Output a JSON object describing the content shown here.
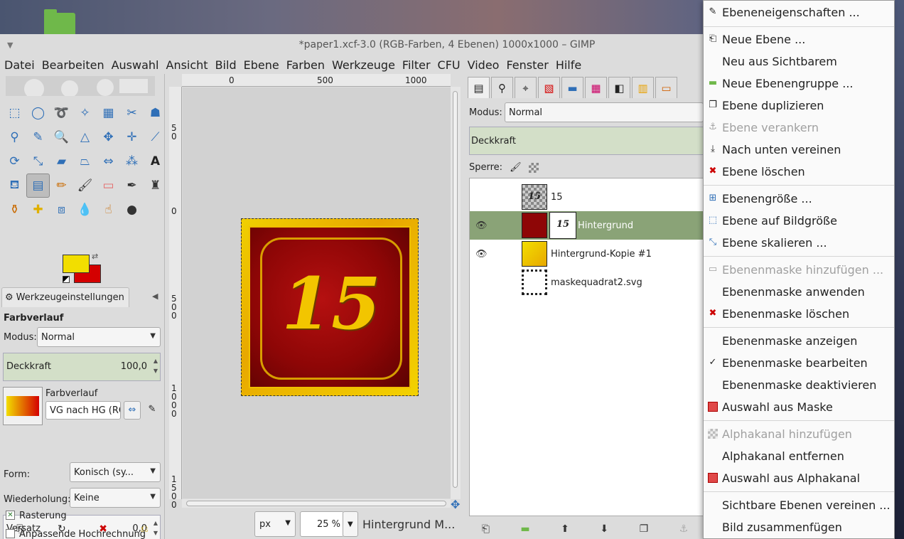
{
  "window": {
    "title": "*paper1.xcf-3.0 (RGB-Farben, 4 Ebenen) 1000x1000 – GIMP"
  },
  "menubar": [
    "Datei",
    "Bearbeiten",
    "Auswahl",
    "Ansicht",
    "Bild",
    "Ebene",
    "Farben",
    "Werkzeuge",
    "Filter",
    "CFU",
    "Video",
    "Fenster",
    "Hilfe"
  ],
  "tool_options": {
    "tab_label": "Werkzeugeinstellungen",
    "tool_name": "Farbverlauf",
    "mode_label": "Modus:",
    "mode_value": "Normal",
    "opacity_label": "Deckkraft",
    "opacity_value": "100,0",
    "gradient_label": "Farbverlauf",
    "gradient_value": "VG nach HG (RG",
    "shape_label": "Form:",
    "shape_value": "Konisch (sy...",
    "repeat_label": "Wiederholung:",
    "repeat_value": "Keine",
    "offset_label": "Versatz",
    "offset_value": "0,0",
    "dither_label": "Rasterung",
    "dither_checked": true,
    "adaptive_label": "Anpassende Hochrechnung",
    "adaptive_checked": false
  },
  "colors": {
    "foreground": "#f2de00",
    "background": "#d40000",
    "selection": "#8aa377",
    "slider": "#d3dfc8"
  },
  "canvas": {
    "ruler_top": [
      "0",
      "500",
      "1000"
    ],
    "ruler_left": [
      "5\n0",
      "0",
      "5\n0\n0",
      "1\n0\n0\n0",
      "1\n5\n0\n0"
    ],
    "image_text": "15",
    "unit": "px",
    "zoom": "25 %",
    "status": "Hintergrund M..."
  },
  "layers": {
    "mode_label": "Modus:",
    "mode_value": "Normal",
    "opacity_label": "Deckkraft",
    "lock_label": "Sperre:",
    "items": [
      {
        "name": "15",
        "visible": false,
        "selected": false,
        "mask": false
      },
      {
        "name": "Hintergrund",
        "visible": true,
        "selected": true,
        "mask": true
      },
      {
        "name": "Hintergrund-Kopie #1",
        "visible": true,
        "selected": false,
        "mask": false
      },
      {
        "name": "maskequadrat2.svg",
        "visible": false,
        "selected": false,
        "mask": false
      }
    ]
  },
  "context_menu": {
    "items": [
      {
        "label": "Ebeneneigenschaften ...",
        "icon": "pencil-icon",
        "disabled": false
      },
      {
        "label": "Neue Ebene ...",
        "icon": "new-layer-icon",
        "disabled": false
      },
      {
        "label": "Neu aus Sichtbarem",
        "icon": "",
        "disabled": false
      },
      {
        "label": "Neue Ebenengruppe ...",
        "icon": "folder-icon",
        "disabled": false
      },
      {
        "label": "Ebene duplizieren",
        "icon": "duplicate-icon",
        "disabled": false
      },
      {
        "label": "Ebene verankern",
        "icon": "anchor-icon",
        "disabled": true
      },
      {
        "label": "Nach unten vereinen",
        "icon": "merge-down-icon",
        "disabled": false
      },
      {
        "label": "Ebene löschen",
        "icon": "delete-icon",
        "disabled": false
      },
      {
        "label": "Ebenengröße ...",
        "icon": "layer-size-icon",
        "disabled": false
      },
      {
        "label": "Ebene auf Bildgröße",
        "icon": "fit-image-icon",
        "disabled": false
      },
      {
        "label": "Ebene skalieren ...",
        "icon": "scale-icon",
        "disabled": false
      },
      {
        "label": "Ebenenmaske hinzufügen ...",
        "icon": "add-mask-icon",
        "disabled": true
      },
      {
        "label": "Ebenenmaske anwenden",
        "icon": "",
        "disabled": false
      },
      {
        "label": "Ebenenmaske löschen",
        "icon": "delete-icon",
        "disabled": false
      },
      {
        "label": "Ebenenmaske anzeigen",
        "icon": "",
        "disabled": false
      },
      {
        "label": "Ebenenmaske bearbeiten",
        "icon": "check-icon",
        "disabled": false
      },
      {
        "label": "Ebenenmaske deaktivieren",
        "icon": "",
        "disabled": false
      },
      {
        "label": "Auswahl aus Maske",
        "icon": "selection-icon",
        "disabled": false
      },
      {
        "label": "Alphakanal hinzufügen",
        "icon": "alpha-icon",
        "disabled": true
      },
      {
        "label": "Alphakanal entfernen",
        "icon": "",
        "disabled": false
      },
      {
        "label": "Auswahl aus Alphakanal",
        "icon": "selection-icon",
        "disabled": false
      },
      {
        "label": "Sichtbare Ebenen vereinen ...",
        "icon": "",
        "disabled": false
      },
      {
        "label": "Bild zusammenfügen",
        "icon": "",
        "disabled": false
      }
    ]
  }
}
